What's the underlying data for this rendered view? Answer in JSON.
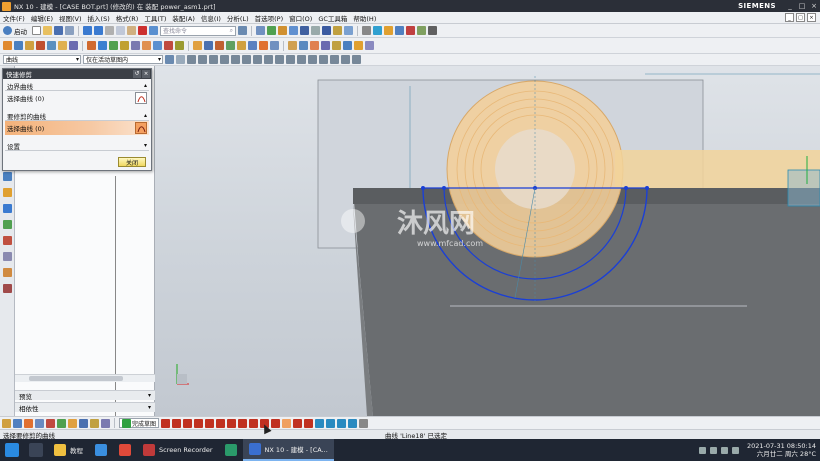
{
  "window": {
    "title": "NX 10 - 建模 - [CASE BOT.prt]  (修改的)  在 装配 power_asm1.prt]",
    "brand": "SIEMENS",
    "controls": [
      "_",
      "□",
      "×"
    ]
  },
  "menu": {
    "items": [
      "文件(F)",
      "编辑(E)",
      "视图(V)",
      "插入(S)",
      "格式(R)",
      "工具(T)",
      "装配(A)",
      "信息(I)",
      "分析(L)",
      "首选项(P)",
      "窗口(O)",
      "GC工具箱",
      "帮助(H)"
    ]
  },
  "toolbar": {
    "start_label": "启动",
    "search_placeholder": "查找命令",
    "filter_value": "曲线",
    "scope_value": "仅在活动草图内"
  },
  "dialog": {
    "title": "快速修剪",
    "group1": {
      "label": "边界曲线",
      "row": "选择曲线 (0)"
    },
    "group2": {
      "label": "要修剪的曲线",
      "row": "选择曲线 (0)"
    },
    "group3": {
      "label": "设置"
    },
    "close_label": "关闭"
  },
  "nav": {
    "sections": [
      "预览",
      "相依性"
    ]
  },
  "bottom_toolbar": {
    "finish_sketch_label": "完成草图"
  },
  "status": {
    "prompt": "选择要修剪的曲线",
    "message": "曲线 'Line18' 已选定"
  },
  "watermark": {
    "cn": "沐风网",
    "url": "www.mfcad.com"
  },
  "taskbar": {
    "apps": [
      {
        "label": "教程",
        "color": "#f0c040"
      },
      {
        "label": "",
        "color": "#3a8fe0"
      },
      {
        "label": "",
        "color": "#e04a3a"
      },
      {
        "label": "Screen Recorder",
        "color": "#c03a3a"
      },
      {
        "label": "",
        "color": "#2a9a6a"
      },
      {
        "label": "NX 10 - 建模 - [CA...",
        "color": "#3a6fd0"
      }
    ],
    "clock_time": "2021-07-31 08:50:14",
    "clock_date": "六月廿二 周六 28°C"
  },
  "colors": {
    "sketch_blue": "#1a3fd6",
    "highlight_orange": "#f0a050",
    "part_gray": "#6a6d70"
  }
}
